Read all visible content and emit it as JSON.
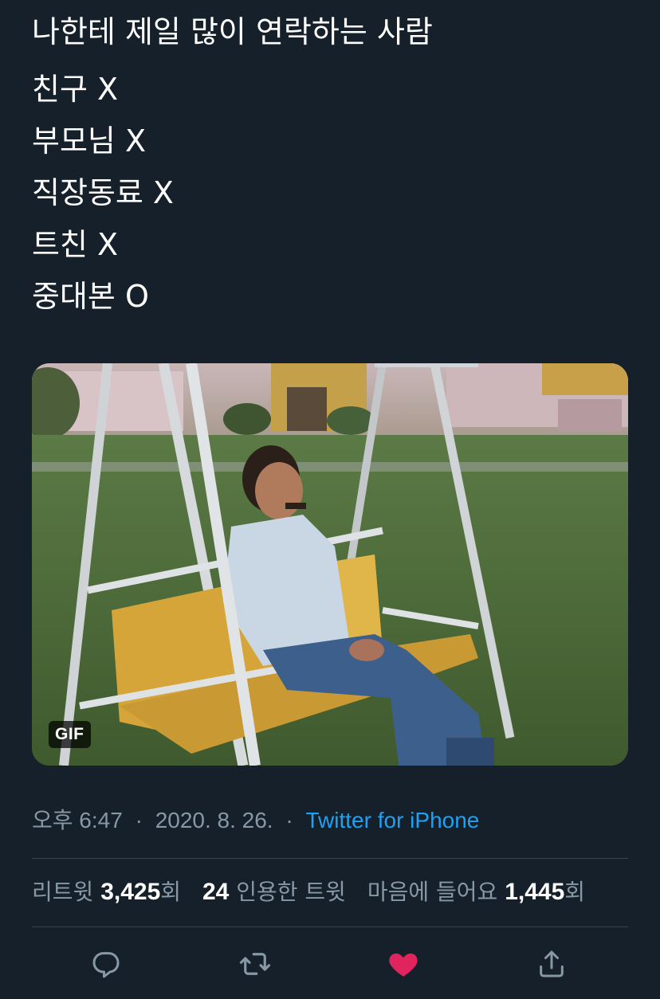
{
  "tweet": {
    "lines": [
      "나한테 제일 많이 연락하는 사람",
      "친구 X",
      "부모님 X",
      "직장동료 X",
      "트친 X",
      "중대본 O"
    ]
  },
  "media": {
    "badge": "GIF",
    "description_icon": "gif-image"
  },
  "meta": {
    "time": "오후 6:47",
    "separator": "·",
    "date": "2020. 8. 26.",
    "separator2": "·",
    "source": "Twitter for iPhone"
  },
  "stats": {
    "retweets_label": "리트윗",
    "retweets_count": "3,425",
    "retweets_suffix": "회",
    "quotes_count": "24",
    "quotes_label": "인용한 트윗",
    "likes_label": "마음에 들어요",
    "likes_count": "1,445",
    "likes_suffix": "회"
  },
  "actions": [
    {
      "icon": "reply-icon"
    },
    {
      "icon": "retweet-icon"
    },
    {
      "icon": "heart-icon",
      "active_color": "#e0245e"
    },
    {
      "icon": "share-icon"
    }
  ],
  "colors": {
    "background": "#15202b",
    "text": "#ffffff",
    "muted": "#8899a6",
    "link": "#1da1f2",
    "divider": "#38444d",
    "like": "#e0245e"
  }
}
